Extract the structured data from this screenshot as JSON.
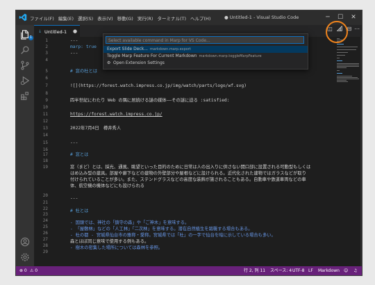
{
  "window": {
    "title": "● Untitled-1 - Visual Studio Code",
    "menu": [
      "ファイル(F)",
      "編集(E)",
      "選択(S)",
      "表示(V)",
      "移動(G)",
      "実行(R)",
      "ターミナル(T)",
      "ヘルプ(H)"
    ],
    "controls": {
      "minimize": "─",
      "maximize": "☐",
      "close": "✕"
    }
  },
  "activity_bar": {
    "items": [
      "explorer-icon",
      "search-icon",
      "source-control-icon",
      "run-debug-icon",
      "extensions-icon"
    ],
    "explorer_badge": "1",
    "bottom": [
      "account-icon",
      "manage-gear-icon"
    ]
  },
  "tab": {
    "label": "Untitled-1",
    "icon": "markdown-icon",
    "close": "●"
  },
  "command_palette": {
    "placeholder": "Select available command in Marp for VS Code...",
    "items": [
      {
        "title": "Export Slide Deck...",
        "detail": "markdown.marp.export",
        "selected": true
      },
      {
        "title": "Toggle Marp Feature For Current Markdown",
        "detail": "markdown.marp.toggleMarpFeature",
        "selected": false
      },
      {
        "title": "Open Extension Settings",
        "detail": "",
        "selected": false
      }
    ]
  },
  "editor": {
    "lines": [
      {
        "n": "1",
        "text": "---"
      },
      {
        "n": "2",
        "key": "marp:",
        "value": " true"
      },
      {
        "n": "3",
        "text": "---"
      },
      {
        "n": "4",
        "text": ""
      },
      {
        "n": "5",
        "text": "# 窓の杜とは",
        "kind": "heading"
      },
      {
        "n": "6",
        "text": ""
      },
      {
        "n": "7",
        "text": "![](https://forest.watch.impress.co.jp/img/watch/parts/logo/wf.svg)",
        "kind": "link"
      },
      {
        "n": "8",
        "text": ""
      },
      {
        "n": "9",
        "text": "四半世紀にわたり Web の隅に居続ける謎の媒体――その謎に迫る :satisfied:"
      },
      {
        "n": "10",
        "text": ""
      },
      {
        "n": "11",
        "text": "https://forest.watch.impress.co.jp/",
        "kind": "link"
      },
      {
        "n": "12",
        "text": ""
      },
      {
        "n": "13",
        "text": "2022年7月4日　樽井秀人"
      },
      {
        "n": "14",
        "text": ""
      },
      {
        "n": "15",
        "text": "---"
      },
      {
        "n": "16",
        "text": ""
      },
      {
        "n": "17",
        "text": "# 窓とは",
        "kind": "heading"
      },
      {
        "n": "18",
        "text": ""
      },
      {
        "n": "19",
        "text": "窓（まど）とは、採光、通風、眺望といった目的のために日常は人の出入りに供さない開口部に設置される可動型もしくは"
      },
      {
        "n": "",
        "text": "はめ込み型の建具。部屋や廊下などの建物の外壁部分や屋根などに設けられる。近代化された建物ではガラスなどが取り"
      },
      {
        "n": "",
        "text": "付けられていることが多い。また、ステンドグラスなどの高度な装飾が施されることもある。自動車や鉄道車両などの車"
      },
      {
        "n": "",
        "text": "体、航空機の機体などにも設けられる"
      },
      {
        "n": "20",
        "text": ""
      },
      {
        "n": "21",
        "text": "---"
      },
      {
        "n": "22",
        "text": ""
      },
      {
        "n": "23",
        "text": "# 杜とは",
        "kind": "heading"
      },
      {
        "n": "24",
        "text": ""
      },
      {
        "n": "25",
        "text": "- 国頭では、神社の「鎮守の森」や「ご神木」を意味する。",
        "kind": "list"
      },
      {
        "n": "26",
        "text": "- 「屋敷林」などの「人工林」「二次林」を意味する。潜在自然植生を踏襲する場合もある。",
        "kind": "list"
      },
      {
        "n": "27",
        "text": "- 杜の都 - 宮城県仙台市の雅称・愛称。宮城県では「杜」の一字で仙台を暗に示している場合も多い。",
        "kind": "list"
      },
      {
        "n": "28",
        "text": "森とほぼ同じ意味で使用する例もある。"
      },
      {
        "n": "29",
        "text": "- 樹木の密集した場所については森林を参照。",
        "kind": "list"
      }
    ]
  },
  "status_bar": {
    "errors": "⊗ 0",
    "warnings": "⚠ 0",
    "position": "行 2, 列 11",
    "spaces": "スペース: 4",
    "encoding": "UTF-8",
    "eol": "LF",
    "language": "Markdown",
    "accent": "#68217a"
  },
  "colors": {
    "highlight_ring": "#f0841d",
    "selection": "#04395e",
    "focus_border": "#0e70c0"
  }
}
